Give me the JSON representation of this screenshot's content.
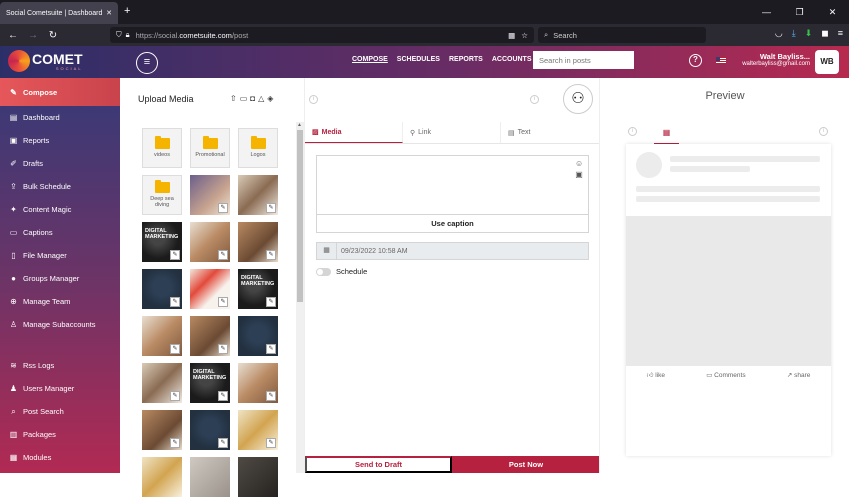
{
  "browser": {
    "tab_title": "Social Cometsuite | Dashboard",
    "url_prefix": "https://social.",
    "url_domain": "cometsuite.com",
    "url_path": "/post",
    "search_placeholder": "Search"
  },
  "header": {
    "logo_text": "COMET",
    "logo_sub": "SOCIAL",
    "nav": [
      "COMPOSE",
      "SCHEDULES",
      "REPORTS",
      "ACCOUNTS"
    ],
    "search_placeholder": "Search in posts",
    "user_name": "Walt Bayliss...",
    "user_email": "walterbayliss@gmail.com",
    "avatar_initials": "WB"
  },
  "sidebar": {
    "items": [
      {
        "label": "Compose",
        "icon": "pencil-icon"
      },
      {
        "label": "Dashboard",
        "icon": "dashboard-icon"
      },
      {
        "label": "Reports",
        "icon": "reports-icon"
      },
      {
        "label": "Drafts",
        "icon": "drafts-icon"
      },
      {
        "label": "Bulk Schedule",
        "icon": "bulk-schedule-icon"
      },
      {
        "label": "Content Magic",
        "icon": "content-magic-icon"
      },
      {
        "label": "Captions",
        "icon": "captions-icon"
      },
      {
        "label": "File Manager",
        "icon": "file-manager-icon"
      },
      {
        "label": "Groups Manager",
        "icon": "groups-icon"
      },
      {
        "label": "Manage Team",
        "icon": "team-icon"
      },
      {
        "label": "Manage Subaccounts",
        "icon": "subaccounts-icon"
      },
      {
        "label": "Rss Logs",
        "icon": "rss-icon"
      },
      {
        "label": "Users Manager",
        "icon": "users-icon"
      },
      {
        "label": "Post Search",
        "icon": "post-search-icon"
      },
      {
        "label": "Packages",
        "icon": "packages-icon"
      },
      {
        "label": "Modules",
        "icon": "modules-icon"
      }
    ]
  },
  "upload": {
    "title": "Upload Media",
    "folders": [
      "videos",
      "Promotional",
      "Logos",
      "Deep sea diving"
    ],
    "thumb_text": "DIGITAL MARKETING"
  },
  "composer": {
    "tabs": [
      "Media",
      "Link",
      "Text"
    ],
    "caption_button": "Use caption",
    "date_value": "09/23/2022 10:58 AM",
    "schedule_label": "Schedule",
    "draft_button": "Send to Draft",
    "post_button": "Post Now"
  },
  "preview": {
    "title": "Preview",
    "actions": [
      "like",
      "Comments",
      "share"
    ]
  },
  "colors": {
    "accent": "#b5213e",
    "header_start": "#2b2f68",
    "header_end": "#b72a50"
  }
}
